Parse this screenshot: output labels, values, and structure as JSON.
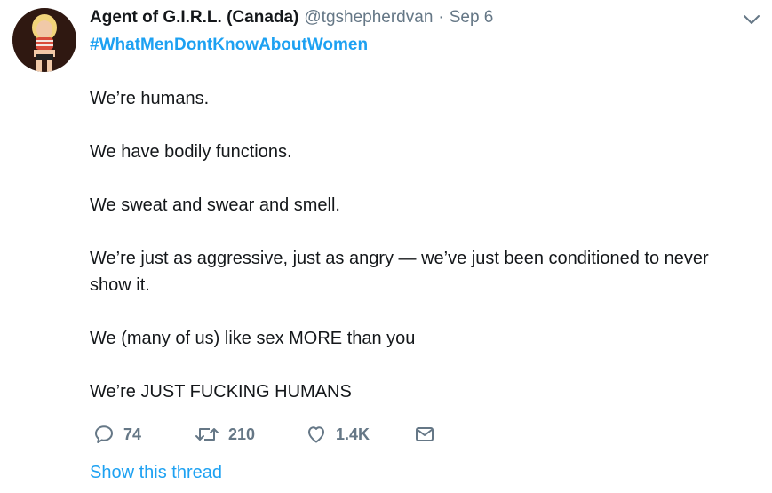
{
  "tweet": {
    "author": {
      "display_name": "Agent of G.I.R.L. (Canada)",
      "handle": "@tgshepherdvan",
      "separator": "·",
      "time": "Sep 6"
    },
    "hashtag": "#WhatMenDontKnowAboutWomen",
    "paragraphs": [
      "We’re humans.",
      "We have bodily functions.",
      "We sweat and swear and smell.",
      "We’re just as aggressive, just as angry — we’ve just been conditioned to never show it.",
      "We (many of us) like sex MORE than you",
      "We’re JUST FUCKING HUMANS"
    ],
    "actions": {
      "reply": {
        "icon": "reply-icon",
        "count": "74"
      },
      "retweet": {
        "icon": "retweet-icon",
        "count": "210"
      },
      "like": {
        "icon": "heart-icon",
        "count": "1.4K"
      },
      "dm": {
        "icon": "envelope-icon"
      }
    },
    "show_thread": "Show this thread"
  },
  "colors": {
    "link": "#1da1f2",
    "muted": "#657786",
    "text": "#14171a"
  }
}
